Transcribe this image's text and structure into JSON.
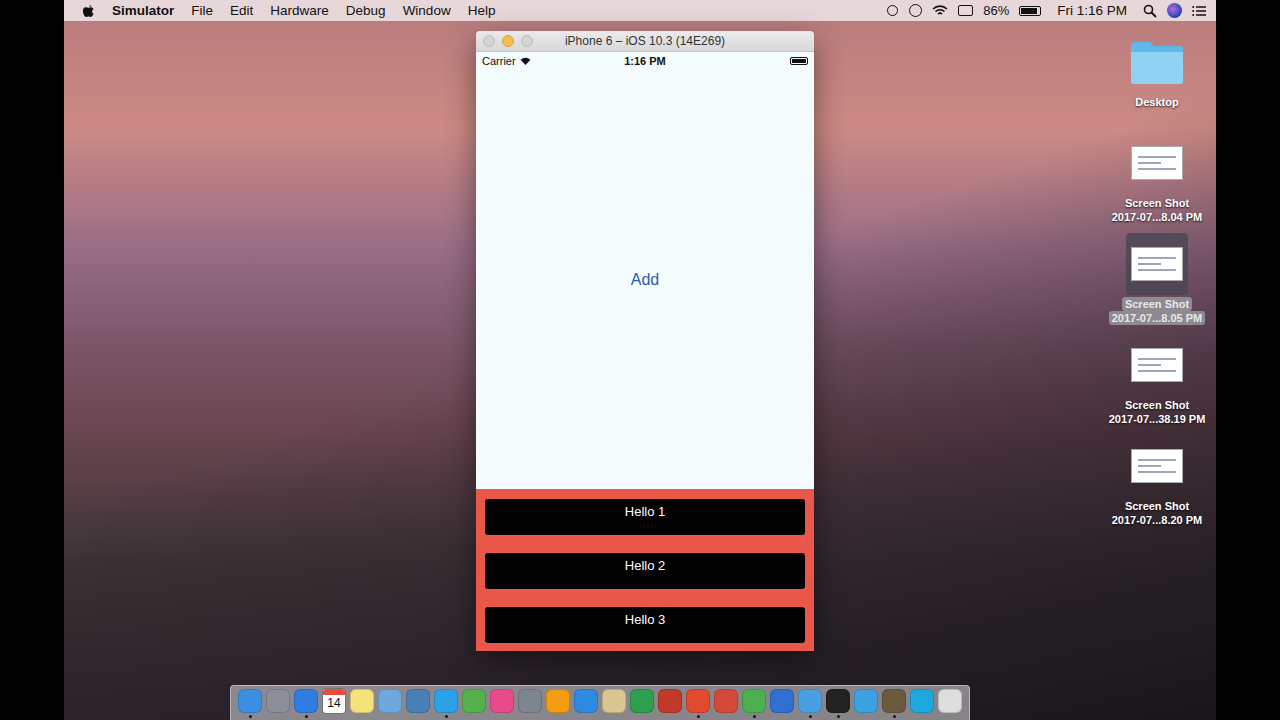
{
  "menubar": {
    "app": "Simulator",
    "menus": [
      "File",
      "Edit",
      "Hardware",
      "Debug",
      "Window",
      "Help"
    ],
    "battery": "86%",
    "clock": "Fri 1:16 PM"
  },
  "simulator": {
    "title": "iPhone 6 – iOS 10.3 (14E269)",
    "carrier": "Carrier",
    "time": "1:16 PM",
    "add_button": "Add",
    "items": [
      "Hello 1",
      "Hello 2",
      "Hello 3"
    ]
  },
  "desktop_icons": [
    {
      "kind": "folder",
      "lines": [
        "Desktop"
      ],
      "selected": false
    },
    {
      "kind": "screenshot",
      "lines": [
        "Screen Shot",
        "2017-07...8.04 PM"
      ],
      "selected": false
    },
    {
      "kind": "screenshot",
      "lines": [
        "Screen Shot",
        "2017-07...8.05 PM"
      ],
      "selected": true
    },
    {
      "kind": "screenshot",
      "lines": [
        "Screen Shot",
        "2017-07...38.19 PM"
      ],
      "selected": false
    },
    {
      "kind": "screenshot",
      "lines": [
        "Screen Shot",
        "2017-07...8.20 PM"
      ],
      "selected": false
    }
  ],
  "dock": {
    "apps": [
      {
        "kind": "app",
        "running": true
      },
      {
        "kind": "app",
        "running": false
      },
      {
        "kind": "app",
        "running": true
      },
      {
        "kind": "calendar",
        "text": "14",
        "running": false
      },
      {
        "kind": "app",
        "running": false
      },
      {
        "kind": "app",
        "running": false
      },
      {
        "kind": "app",
        "running": false
      },
      {
        "kind": "app",
        "running": true
      },
      {
        "kind": "app",
        "running": false
      },
      {
        "kind": "app",
        "running": false
      },
      {
        "kind": "app",
        "running": false
      },
      {
        "kind": "app",
        "running": false
      },
      {
        "kind": "app",
        "running": false
      },
      {
        "kind": "app",
        "running": false
      },
      {
        "kind": "app",
        "running": false
      },
      {
        "kind": "app",
        "running": false
      },
      {
        "kind": "app",
        "running": true
      },
      {
        "kind": "app",
        "running": false
      },
      {
        "kind": "app",
        "running": true
      },
      {
        "kind": "app",
        "running": false
      },
      {
        "kind": "app",
        "running": true
      },
      {
        "kind": "app",
        "running": true
      },
      {
        "kind": "app",
        "running": false
      },
      {
        "kind": "app",
        "running": true
      },
      {
        "kind": "app",
        "running": false
      },
      {
        "kind": "app",
        "running": false
      }
    ]
  }
}
